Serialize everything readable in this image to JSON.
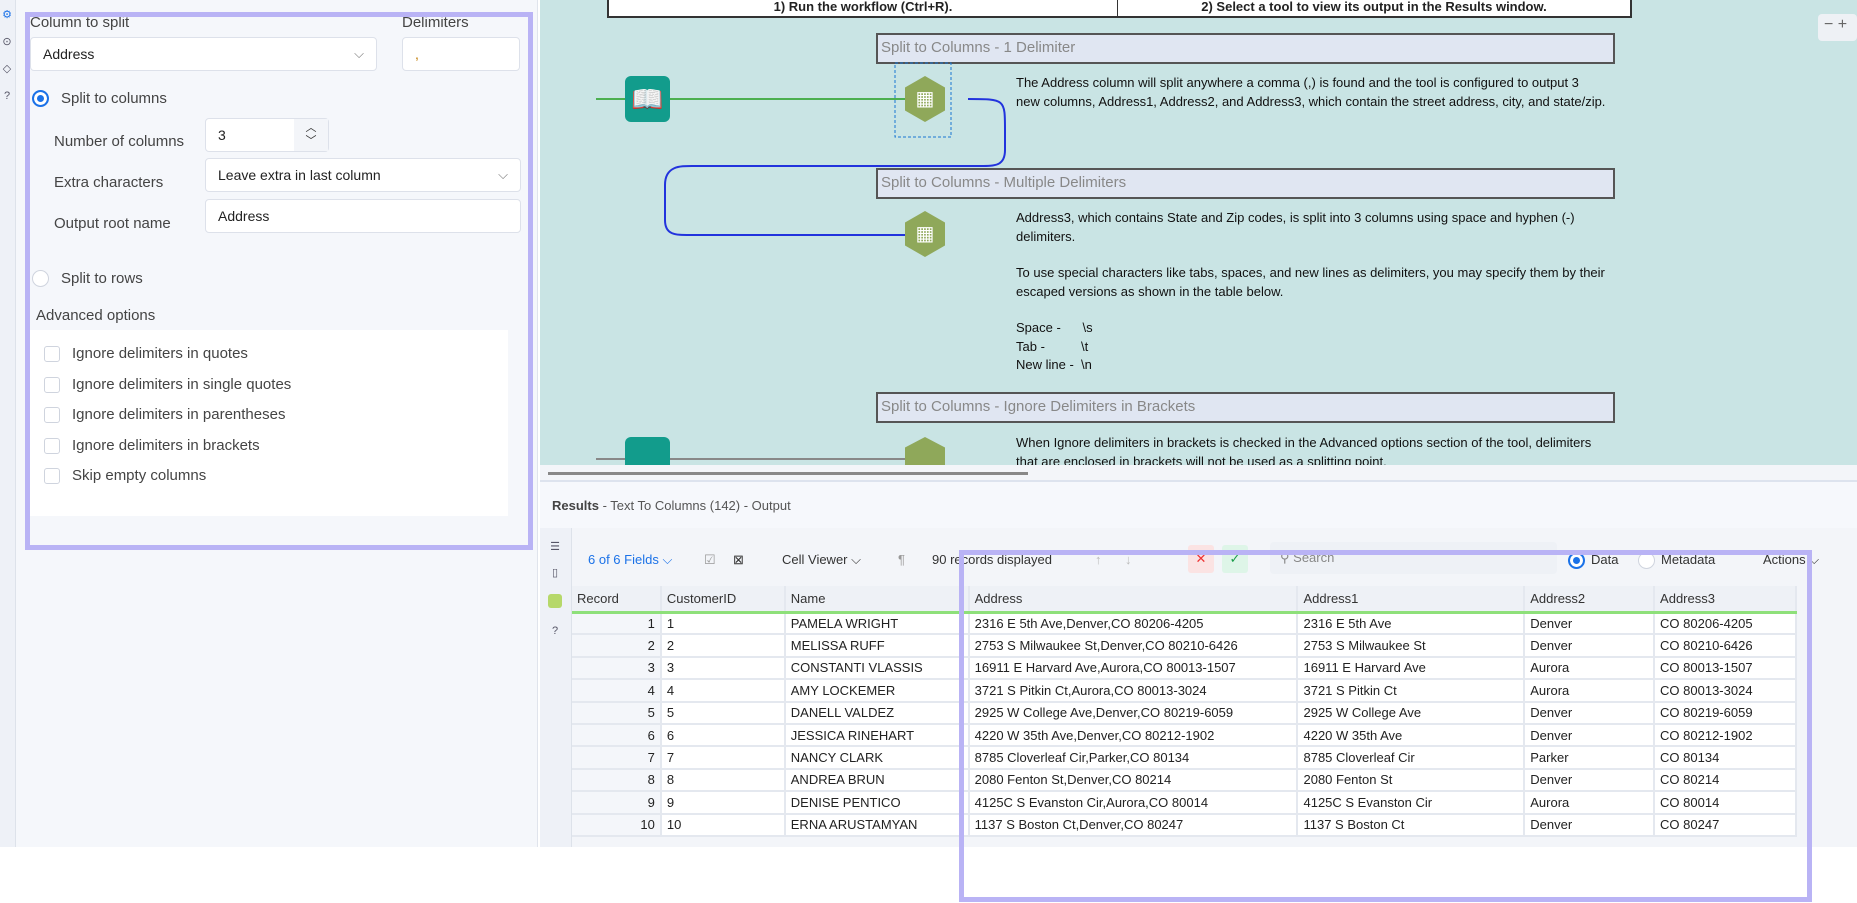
{
  "config": {
    "column_to_split_label": "Column to split",
    "column_to_split_value": "Address",
    "delimiters_label": "Delimiters",
    "delimiters_value": ",",
    "split_to_columns_label": "Split to columns",
    "number_of_columns_label": "Number of columns",
    "number_of_columns_value": "3",
    "extra_characters_label": "Extra characters",
    "extra_characters_value": "Leave extra in last column",
    "output_root_name_label": "Output root name",
    "output_root_name_value": "Address",
    "split_to_rows_label": "Split to rows",
    "selected_mode": "Split to columns",
    "advanced_label": "Advanced options",
    "advanced_options": [
      {
        "label": "Ignore delimiters in quotes",
        "checked": false
      },
      {
        "label": "Ignore delimiters in single quotes",
        "checked": false
      },
      {
        "label": "Ignore delimiters in parentheses",
        "checked": false
      },
      {
        "label": "Ignore delimiters in brackets",
        "checked": false
      },
      {
        "label": "Skip empty columns",
        "checked": false
      }
    ]
  },
  "canvas": {
    "instructions": [
      "1) Run the workflow (Ctrl+R).",
      "2) Select a tool to view its output in the Results window."
    ],
    "comments": [
      {
        "title": "Split to Columns - 1 Delimiter",
        "text": "The Address column will split anywhere a comma (,) is found and the tool is configured to output 3 new columns, Address1, Address2, and Address3, which contain the street address, city, and state/zip."
      },
      {
        "title": "Split to Columns - Multiple Delimiters",
        "text": "Address3, which contains State and Zip codes, is split into 3 columns using space and hyphen (-) delimiters.",
        "text2": "To use special characters like tabs, spaces, and new lines as delimiters, you may specify them by their escaped versions as shown in the table below.",
        "escapes": [
          "Space -      \\s",
          "Tab -          \\t",
          "New line -  \\n"
        ]
      },
      {
        "title": "Split to Columns - Ignore Delimiters in Brackets",
        "text": "When Ignore delimiters in brackets is checked in the Advanced options section of the tool, delimiters that are enclosed in brackets will not be used as a splitting point."
      }
    ],
    "zoom_minus": "−",
    "zoom_plus": "+"
  },
  "results": {
    "title": "Results",
    "subtitle": " - Text To Columns (142) - Output",
    "fields": "6 of 6 Fields",
    "cell_viewer": "Cell Viewer",
    "records": "90 records displayed",
    "search_placeholder": "Search",
    "data_label": "Data",
    "metadata_label": "Metadata",
    "actions_label": "Actions",
    "columns": [
      "Record",
      "CustomerID",
      "Name",
      "Address",
      "Address1",
      "Address2",
      "Address3"
    ],
    "rows": [
      [
        "1",
        "1",
        "PAMELA WRIGHT",
        "2316 E 5th Ave,Denver,CO 80206-4205",
        "2316 E 5th Ave",
        "Denver",
        "CO 80206-4205"
      ],
      [
        "2",
        "2",
        "MELISSA RUFF",
        "2753 S Milwaukee St,Denver,CO 80210-6426",
        "2753 S Milwaukee St",
        "Denver",
        "CO 80210-6426"
      ],
      [
        "3",
        "3",
        "CONSTANTI VLASSIS",
        "16911 E Harvard Ave,Aurora,CO 80013-1507",
        "16911 E Harvard Ave",
        "Aurora",
        "CO 80013-1507"
      ],
      [
        "4",
        "4",
        "AMY LOCKEMER",
        "3721 S Pitkin Ct,Aurora,CO 80013-3024",
        "3721 S Pitkin Ct",
        "Aurora",
        "CO 80013-3024"
      ],
      [
        "5",
        "5",
        "DANELL VALDEZ",
        "2925 W College Ave,Denver,CO 80219-6059",
        "2925 W College Ave",
        "Denver",
        "CO 80219-6059"
      ],
      [
        "6",
        "6",
        "JESSICA RINEHART",
        "4220 W 35th Ave,Denver,CO 80212-1902",
        "4220 W 35th Ave",
        "Denver",
        "CO 80212-1902"
      ],
      [
        "7",
        "7",
        "NANCY CLARK",
        "8785 Cloverleaf Cir,Parker,CO 80134",
        "8785 Cloverleaf Cir",
        "Parker",
        "CO 80134"
      ],
      [
        "8",
        "8",
        "ANDREA BRUN",
        "2080 Fenton St,Denver,CO 80214",
        "2080 Fenton St",
        "Denver",
        "CO 80214"
      ],
      [
        "9",
        "9",
        "DENISE PENTICO",
        "4125C S Evanston Cir,Aurora,CO 80014",
        "4125C S Evanston Cir",
        "Aurora",
        "CO 80014"
      ],
      [
        "10",
        "10",
        "ERNA ARUSTAMYAN",
        "1137 S Boston Ct,Denver,CO 80247",
        "1137 S Boston Ct",
        "Denver",
        "CO 80247"
      ]
    ]
  },
  "colors": {
    "accent": "#1b72e8",
    "highlight": "#b9b3f5",
    "canvas": "#c9e4e4",
    "tool_green": "#8fa85a",
    "input_teal": "#129c8c"
  }
}
